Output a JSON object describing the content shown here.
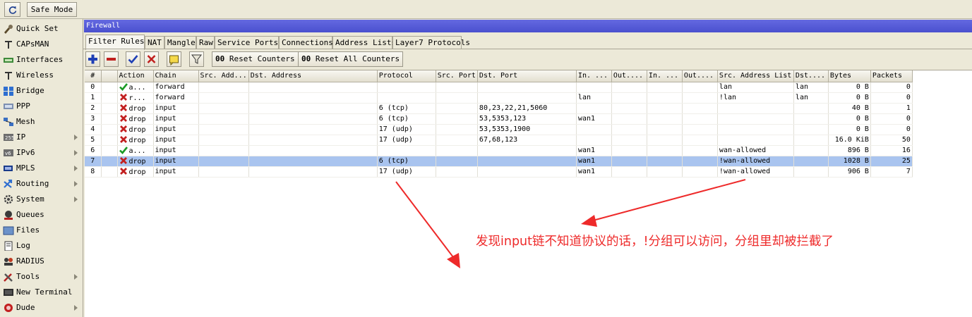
{
  "topbar": {
    "undo_icon": "undo-icon",
    "safe_mode_label": "Safe Mode"
  },
  "sidebar": {
    "items": [
      {
        "label": "Quick Set",
        "icon": "quick-set-icon",
        "submenu": false
      },
      {
        "label": "CAPsMAN",
        "icon": "capsman-icon",
        "submenu": false
      },
      {
        "label": "Interfaces",
        "icon": "interfaces-icon",
        "submenu": false
      },
      {
        "label": "Wireless",
        "icon": "wireless-icon",
        "submenu": false
      },
      {
        "label": "Bridge",
        "icon": "bridge-icon",
        "submenu": false
      },
      {
        "label": "PPP",
        "icon": "ppp-icon",
        "submenu": false
      },
      {
        "label": "Mesh",
        "icon": "mesh-icon",
        "submenu": false
      },
      {
        "label": "IP",
        "icon": "ip-icon",
        "submenu": true
      },
      {
        "label": "IPv6",
        "icon": "ipv6-icon",
        "submenu": true
      },
      {
        "label": "MPLS",
        "icon": "mpls-icon",
        "submenu": true
      },
      {
        "label": "Routing",
        "icon": "routing-icon",
        "submenu": true
      },
      {
        "label": "System",
        "icon": "system-icon",
        "submenu": true
      },
      {
        "label": "Queues",
        "icon": "queues-icon",
        "submenu": false
      },
      {
        "label": "Files",
        "icon": "files-icon",
        "submenu": false
      },
      {
        "label": "Log",
        "icon": "log-icon",
        "submenu": false
      },
      {
        "label": "RADIUS",
        "icon": "radius-icon",
        "submenu": false
      },
      {
        "label": "Tools",
        "icon": "tools-icon",
        "submenu": true
      },
      {
        "label": "New Terminal",
        "icon": "terminal-icon",
        "submenu": false
      },
      {
        "label": "Dude",
        "icon": "dude-icon",
        "submenu": true
      }
    ]
  },
  "window": {
    "title": "Firewall",
    "tabs": [
      "Filter Rules",
      "NAT",
      "Mangle",
      "Raw",
      "Service Ports",
      "Connections",
      "Address Lists",
      "Layer7 Protocols"
    ],
    "active_tab": "Filter Rules",
    "toolbar": {
      "add_icon": "plus-icon",
      "remove_icon": "minus-icon",
      "enable_icon": "check-icon",
      "disable_icon": "x-icon",
      "comment_icon": "comment-icon",
      "filter_icon": "filter-icon",
      "reset_counters_label": "Reset Counters",
      "reset_all_counters_label": "Reset All Counters",
      "counter_badge": "00"
    }
  },
  "table": {
    "columns": [
      "#",
      "",
      "Action",
      "Chain",
      "Src. Add...",
      "Dst. Address",
      "Protocol",
      "Src. Port",
      "Dst. Port",
      "In. ...",
      "Out....",
      "In. ...",
      "Out....",
      "Src. Address List",
      "Dst....",
      "Bytes",
      "Packets"
    ],
    "rows": [
      {
        "num": "0",
        "action_type": "accept",
        "action": "a...",
        "chain": "forward",
        "src_addr": "",
        "dst_addr": "",
        "protocol": "",
        "src_port": "",
        "dst_port": "",
        "in_iface": "",
        "out_iface": "",
        "in_list": "",
        "out_list": "",
        "src_list": "lan",
        "dst_list": "lan",
        "bytes": "0 B",
        "packets": "0",
        "selected": false
      },
      {
        "num": "1",
        "action_type": "reject",
        "action": "r...",
        "chain": "forward",
        "src_addr": "",
        "dst_addr": "",
        "protocol": "",
        "src_port": "",
        "dst_port": "",
        "in_iface": "lan",
        "out_iface": "",
        "in_list": "",
        "out_list": "",
        "src_list": "!lan",
        "dst_list": "lan",
        "bytes": "0 B",
        "packets": "0",
        "selected": false
      },
      {
        "num": "2",
        "action_type": "drop",
        "action": "drop",
        "chain": "input",
        "src_addr": "",
        "dst_addr": "",
        "protocol": "6 (tcp)",
        "src_port": "",
        "dst_port": "80,23,22,21,5060",
        "in_iface": "",
        "out_iface": "",
        "in_list": "",
        "out_list": "",
        "src_list": "",
        "dst_list": "",
        "bytes": "40 B",
        "packets": "1",
        "selected": false
      },
      {
        "num": "3",
        "action_type": "drop",
        "action": "drop",
        "chain": "input",
        "src_addr": "",
        "dst_addr": "",
        "protocol": "6 (tcp)",
        "src_port": "",
        "dst_port": "53,5353,123",
        "in_iface": "wan1",
        "out_iface": "",
        "in_list": "",
        "out_list": "",
        "src_list": "",
        "dst_list": "",
        "bytes": "0 B",
        "packets": "0",
        "selected": false
      },
      {
        "num": "4",
        "action_type": "drop",
        "action": "drop",
        "chain": "input",
        "src_addr": "",
        "dst_addr": "",
        "protocol": "17 (udp)",
        "src_port": "",
        "dst_port": "53,5353,1900",
        "in_iface": "",
        "out_iface": "",
        "in_list": "",
        "out_list": "",
        "src_list": "",
        "dst_list": "",
        "bytes": "0 B",
        "packets": "0",
        "selected": false
      },
      {
        "num": "5",
        "action_type": "drop",
        "action": "drop",
        "chain": "input",
        "src_addr": "",
        "dst_addr": "",
        "protocol": "17 (udp)",
        "src_port": "",
        "dst_port": "67,68,123",
        "in_iface": "",
        "out_iface": "",
        "in_list": "",
        "out_list": "",
        "src_list": "",
        "dst_list": "",
        "bytes": "16.0 KiB",
        "packets": "50",
        "selected": false
      },
      {
        "num": "6",
        "action_type": "accept",
        "action": "a...",
        "chain": "input",
        "src_addr": "",
        "dst_addr": "",
        "protocol": "",
        "src_port": "",
        "dst_port": "",
        "in_iface": "wan1",
        "out_iface": "",
        "in_list": "",
        "out_list": "",
        "src_list": "wan-allowed",
        "dst_list": "",
        "bytes": "896 B",
        "packets": "16",
        "selected": false
      },
      {
        "num": "7",
        "action_type": "drop",
        "action": "drop",
        "chain": "input",
        "src_addr": "",
        "dst_addr": "",
        "protocol": "6 (tcp)",
        "src_port": "",
        "dst_port": "",
        "in_iface": "wan1",
        "out_iface": "",
        "in_list": "",
        "out_list": "",
        "src_list": "!wan-allowed",
        "dst_list": "",
        "bytes": "1028 B",
        "packets": "25",
        "selected": true
      },
      {
        "num": "8",
        "action_type": "drop",
        "action": "drop",
        "chain": "input",
        "src_addr": "",
        "dst_addr": "",
        "protocol": "17 (udp)",
        "src_port": "",
        "dst_port": "",
        "in_iface": "wan1",
        "out_iface": "",
        "in_list": "",
        "out_list": "",
        "src_list": "!wan-allowed",
        "dst_list": "",
        "bytes": "906 B",
        "packets": "7",
        "selected": false
      }
    ]
  },
  "annotation": {
    "text": "发现input链不知道协议的话，!分组可以访问，分组里却被拦截了",
    "color": "#ee2a2a"
  }
}
